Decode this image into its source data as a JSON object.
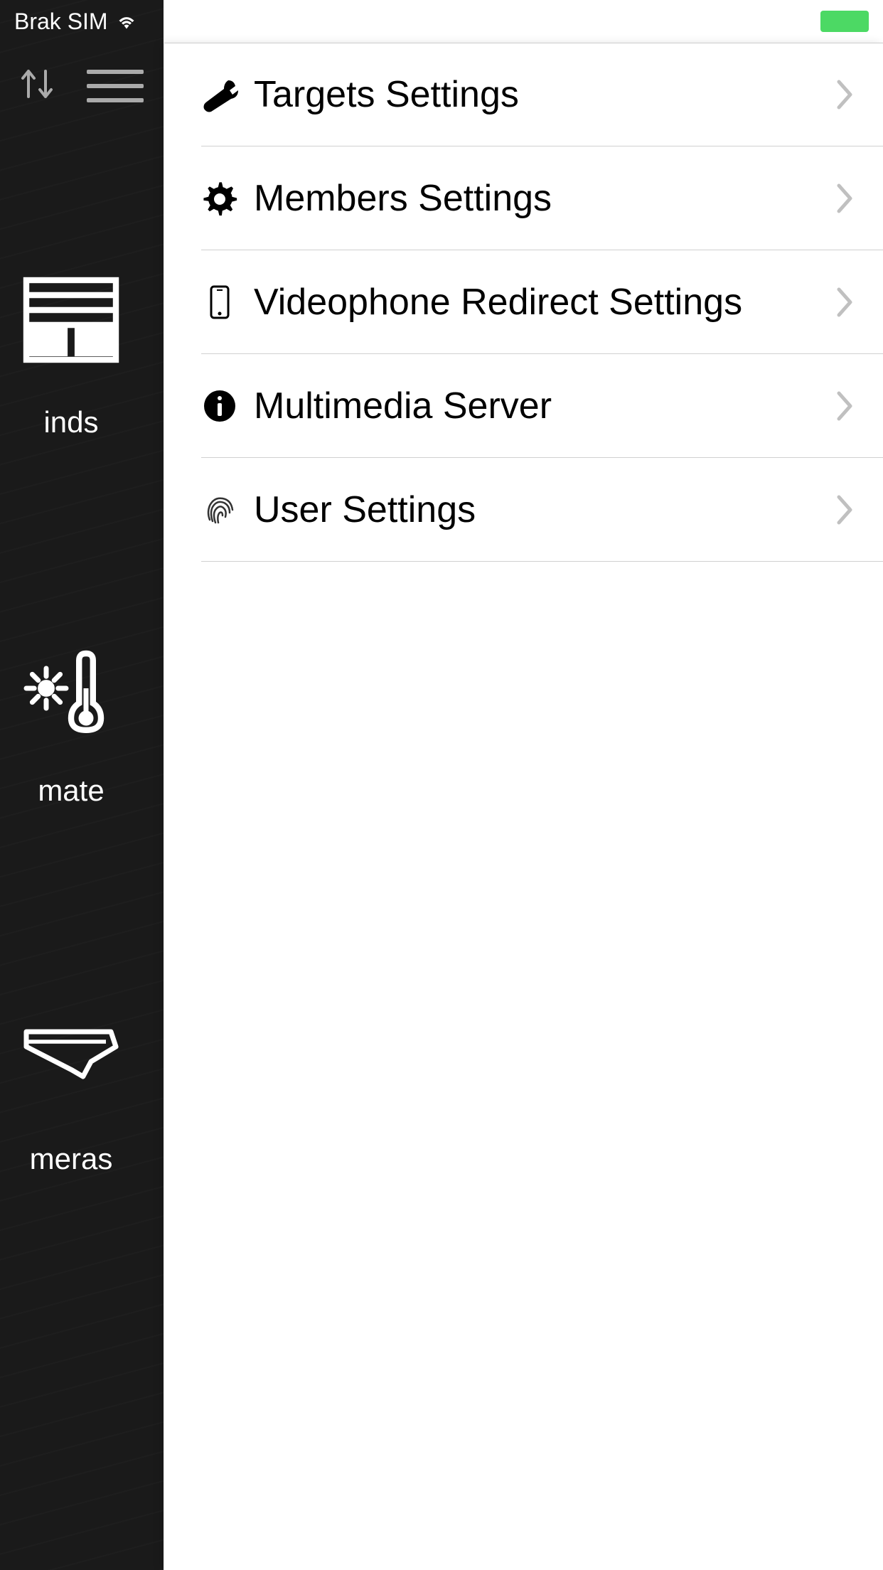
{
  "status_bar": {
    "sim_text": "Brak SIM"
  },
  "sidebar": {
    "items": [
      {
        "label": "inds",
        "icon": "blinds"
      },
      {
        "label": "mate",
        "icon": "climate"
      },
      {
        "label": "meras",
        "icon": "camera"
      }
    ]
  },
  "settings": {
    "items": [
      {
        "label": "Targets Settings",
        "icon": "wrench"
      },
      {
        "label": "Members Settings",
        "icon": "gear"
      },
      {
        "label": "Videophone Redirect Settings",
        "icon": "phone"
      },
      {
        "label": "Multimedia Server",
        "icon": "info"
      },
      {
        "label": "User Settings",
        "icon": "fingerprint"
      }
    ]
  }
}
